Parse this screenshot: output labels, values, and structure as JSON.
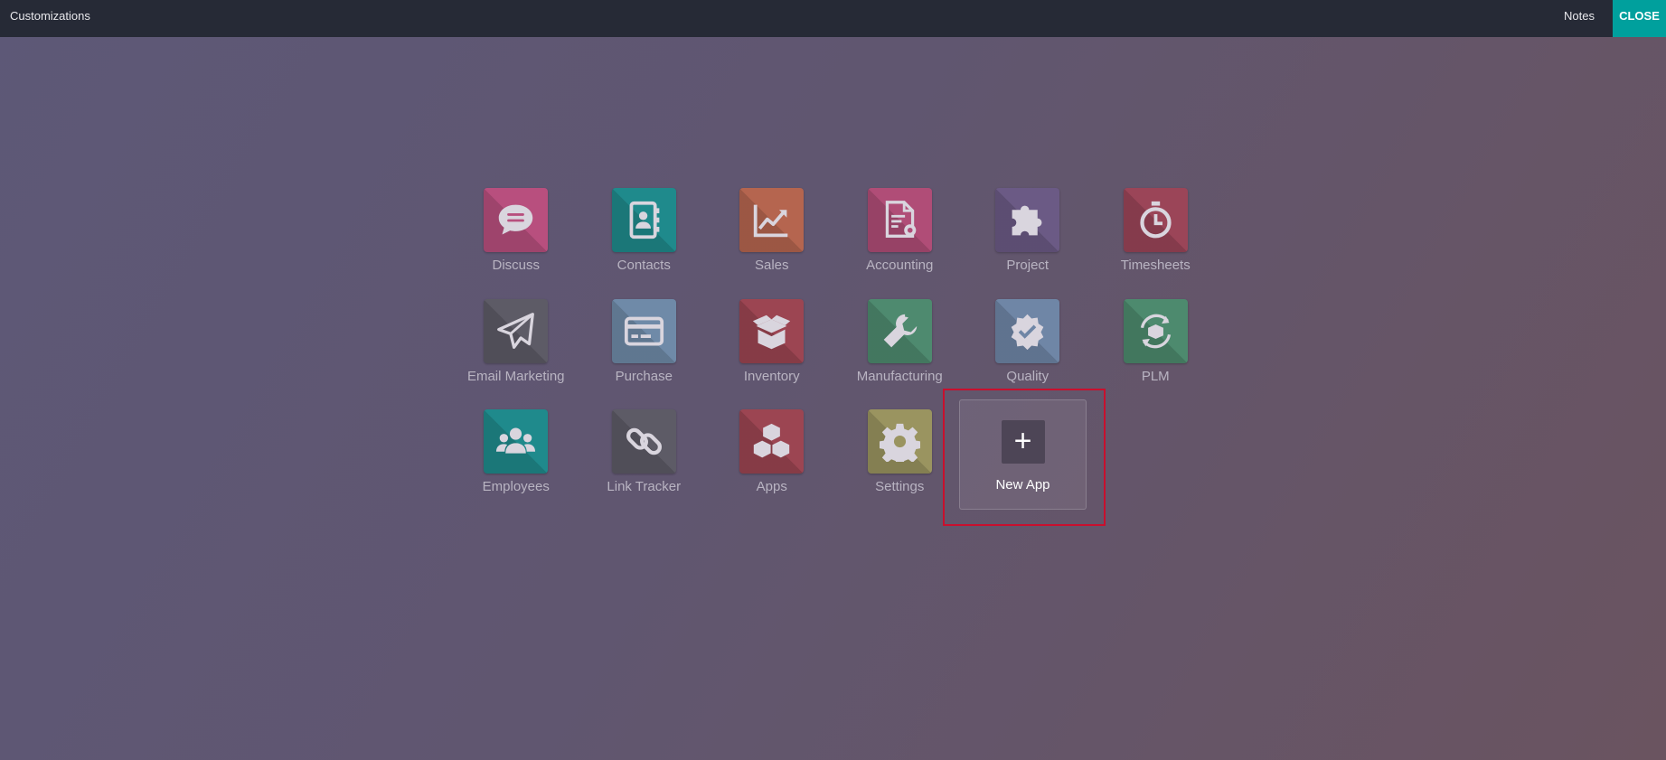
{
  "topbar": {
    "title": "Customizations",
    "notes_label": "Notes",
    "close_label": "CLOSE"
  },
  "apps": [
    {
      "label": "Discuss",
      "color": "#b84f7e",
      "icon": "chat-bubble-icon"
    },
    {
      "label": "Contacts",
      "color": "#1f8a8c",
      "icon": "contact-book-icon"
    },
    {
      "label": "Sales",
      "color": "#b5654f",
      "icon": "trend-chart-icon"
    },
    {
      "label": "Accounting",
      "color": "#b04d77",
      "icon": "invoice-gear-icon"
    },
    {
      "label": "Project",
      "color": "#6b5a85",
      "icon": "puzzle-icon"
    },
    {
      "label": "Timesheets",
      "color": "#9b4558",
      "icon": "stopwatch-icon"
    },
    {
      "label": "Email Marketing",
      "color": "#5d5b66",
      "icon": "paper-plane-icon"
    },
    {
      "label": "Purchase",
      "color": "#6f8aa8",
      "icon": "credit-card-icon"
    },
    {
      "label": "Inventory",
      "color": "#9c4552",
      "icon": "open-box-icon"
    },
    {
      "label": "Manufacturing",
      "color": "#4e8a6f",
      "icon": "wrench-icon"
    },
    {
      "label": "Quality",
      "color": "#6f86a6",
      "icon": "badge-check-icon"
    },
    {
      "label": "PLM",
      "color": "#4d8a6e",
      "icon": "cycle-box-icon"
    },
    {
      "label": "Employees",
      "color": "#1f8a8c",
      "icon": "people-icon"
    },
    {
      "label": "Link Tracker",
      "color": "#5d5b66",
      "icon": "link-icon"
    },
    {
      "label": "Apps",
      "color": "#9c4552",
      "icon": "cubes-icon"
    },
    {
      "label": "Settings",
      "color": "#9a9460",
      "icon": "gear-icon"
    }
  ],
  "new_app": {
    "label": "New App",
    "plus": "+"
  }
}
